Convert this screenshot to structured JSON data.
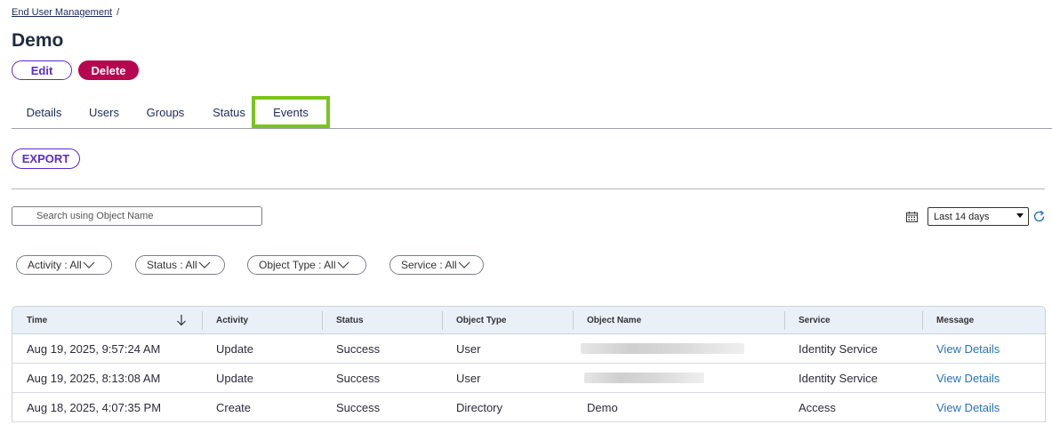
{
  "breadcrumb": {
    "parent": "End User Management",
    "separator": "/"
  },
  "page": {
    "title": "Demo"
  },
  "actions": {
    "edit": "Edit",
    "delete": "Delete"
  },
  "tabs": [
    {
      "label": "Details"
    },
    {
      "label": "Users"
    },
    {
      "label": "Groups"
    },
    {
      "label": "Status"
    },
    {
      "label": "Events",
      "active": true
    }
  ],
  "export": {
    "label": "EXPORT"
  },
  "search": {
    "placeholder": "Search using Object Name",
    "icon": "search-icon"
  },
  "date_range": {
    "selected": "Last 14 days",
    "icon": "calendar-icon"
  },
  "filters": [
    {
      "label": "Activity : All"
    },
    {
      "label": "Status : All"
    },
    {
      "label": "Object Type : All"
    },
    {
      "label": "Service : All"
    }
  ],
  "table": {
    "columns": [
      "Time",
      "Activity",
      "Status",
      "Object Type",
      "Object Name",
      "Service",
      "Message"
    ],
    "sort_column": "Time",
    "sort_direction": "descending",
    "rows": [
      {
        "time": "Aug 19, 2025, 9:57:24 AM",
        "activity": "Update",
        "status": "Success",
        "object_type": "User",
        "object_name": "",
        "object_name_redacted": true,
        "service": "Identity Service",
        "message": "View Details"
      },
      {
        "time": "Aug 19, 2025, 8:13:08 AM",
        "activity": "Update",
        "status": "Success",
        "object_type": "User",
        "object_name": "",
        "object_name_redacted": true,
        "service": "Identity Service",
        "message": "View Details"
      },
      {
        "time": "Aug 18, 2025, 4:07:35 PM",
        "activity": "Create",
        "status": "Success",
        "object_type": "Directory",
        "object_name": "Demo",
        "object_name_redacted": false,
        "service": "Access",
        "message": "View Details"
      }
    ]
  },
  "colors": {
    "accent": "#5b2bd0",
    "danger": "#b5064f",
    "active_tab_border": "#7bc41e",
    "link": "#2a72b5",
    "header_bg": "#eaf0f8"
  }
}
